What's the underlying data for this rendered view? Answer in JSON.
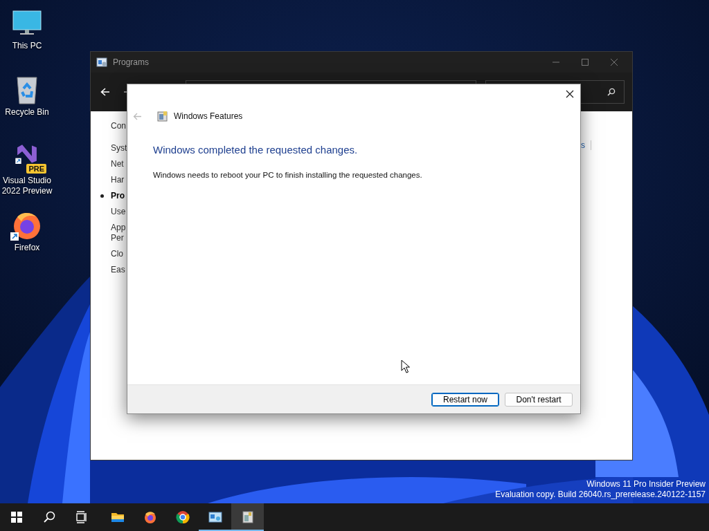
{
  "desktop_icons": [
    {
      "kind": "pc",
      "label": "This PC",
      "shortcut": false
    },
    {
      "kind": "recycle",
      "label": "Recycle Bin",
      "shortcut": false
    },
    {
      "kind": "vs",
      "label": "Visual Studio\n2022 Preview",
      "shortcut": true,
      "badge": "PRE"
    },
    {
      "kind": "firefox",
      "label": "Firefox",
      "shortcut": true
    }
  ],
  "control_panel_window": {
    "title": "Programs",
    "sidebar": [
      {
        "label": "Con",
        "selected": false
      },
      {
        "label": "Syst",
        "selected": false
      },
      {
        "label": "Net",
        "selected": false
      },
      {
        "label": "Har",
        "selected": false
      },
      {
        "label": "Pro",
        "selected": true
      },
      {
        "label": "Use",
        "selected": false
      },
      {
        "label": "App\nPer",
        "selected": false
      },
      {
        "label": "Clo",
        "selected": false
      },
      {
        "label": "Eas",
        "selected": false
      }
    ],
    "link_fragment": "s"
  },
  "dialog": {
    "title": "Windows Features",
    "heading": "Windows completed the requested changes.",
    "message": "Windows needs to reboot your PC to finish installing the requested changes.",
    "buttons": [
      {
        "label": "Restart now",
        "default": true
      },
      {
        "label": "Don't restart",
        "default": false
      }
    ]
  },
  "build_info": [
    "Windows 11 Pro Insider Preview",
    "Evaluation copy. Build 26040.rs_prerelease.240122-1157"
  ],
  "taskbar": [
    {
      "kind": "start",
      "running": false,
      "selected": false
    },
    {
      "kind": "search",
      "running": false,
      "selected": false
    },
    {
      "kind": "taskview",
      "running": false,
      "selected": false
    },
    {
      "kind": "explorer",
      "running": false,
      "selected": false
    },
    {
      "kind": "firefox",
      "running": false,
      "selected": false
    },
    {
      "kind": "chrome",
      "running": false,
      "selected": false
    },
    {
      "kind": "controlpanel",
      "running": true,
      "selected": false
    },
    {
      "kind": "features",
      "running": true,
      "selected": true
    }
  ]
}
